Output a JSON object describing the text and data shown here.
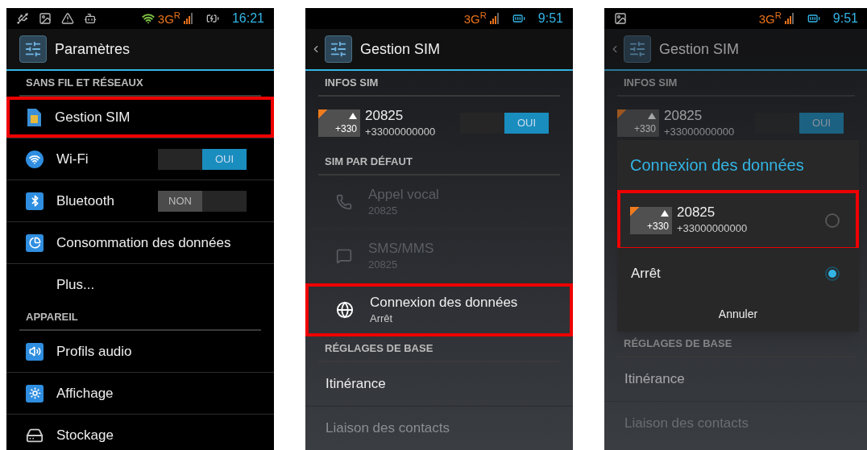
{
  "screens": [
    {
      "dimmed": false,
      "status_bar": {
        "wifi": true,
        "network": "3G$^{R}$",
        "charging": true,
        "time": "16:21"
      },
      "action_bar": {
        "title": "Paramètres"
      },
      "sections": [
        {
          "kind": "group",
          "header": "SANS FIL ET RÉSEAUX",
          "items": [
            {
              "kind": "sim",
              "label": "Gestion SIM",
              "highlighted": true
            },
            {
              "kind": "wifi",
              "label": "Wi-Fi",
              "on": true,
              "toggle_label": "OUI",
              "highlighted": false
            },
            {
              "kind": "bluetooth",
              "label": "Bluetooth",
              "on": false,
              "toggle_label": "NON",
              "highlighted": false
            },
            {
              "kind": "data",
              "label": "Consommation des données",
              "highlighted": false
            },
            {
              "kind": "more",
              "label": "Plus...",
              "highlighted": false
            }
          ]
        },
        {
          "kind": "group",
          "header": "APPAREIL",
          "items": [
            {
              "kind": "audio",
              "label": "Profils audio",
              "highlighted": false
            },
            {
              "kind": "display",
              "label": "Affichage",
              "highlighted": false
            },
            {
              "kind": "storage",
              "label": "Stockage",
              "highlighted": false
            }
          ]
        }
      ]
    },
    {
      "dimmed": false,
      "status_bar": {
        "network": "3G$^{R}$",
        "charging": false,
        "time": "9:51"
      },
      "action_bar": {
        "back": true,
        "title": "Gestion SIM"
      },
      "sections": [
        {
          "kind": "group",
          "header": "INFOS SIM",
          "items": [
            {
              "kind": "sim_entry",
              "badge": "+330",
              "name": "20825",
              "number": "+33000000000",
              "on": true,
              "toggle_label": "OUI",
              "highlighted": false
            }
          ]
        },
        {
          "kind": "group",
          "header": "SIM PAR DÉFAUT",
          "items": [
            {
              "kind": "phone",
              "label": "Appel vocal",
              "sub": "20825",
              "disabled": true,
              "highlighted": false
            },
            {
              "kind": "sms",
              "label": "SMS/MMS",
              "sub": "20825",
              "disabled": true,
              "highlighted": false
            },
            {
              "kind": "globe",
              "label": "Connexion des données",
              "sub": "Arrêt",
              "disabled": false,
              "highlighted": true
            }
          ]
        },
        {
          "kind": "group",
          "header": "RÉGLAGES DE BASE",
          "items": [
            {
              "kind": "text",
              "label": "Itinérance",
              "disabled": false,
              "highlighted": false
            },
            {
              "kind": "text",
              "label": "Liaison des contacts",
              "disabled": true,
              "highlighted": false
            }
          ]
        }
      ]
    },
    {
      "dimmed": true,
      "status_bar": {
        "network": "3G$^{R}$",
        "charging": false,
        "time": "9:51"
      },
      "action_bar": {
        "back": true,
        "title": "Gestion SIM"
      },
      "sections": [
        {
          "kind": "group",
          "header": "INFOS SIM",
          "items": [
            {
              "kind": "sim_entry",
              "badge": "+330",
              "name": "20825",
              "number": "+33000000000",
              "on": true,
              "toggle_label": "OUI",
              "highlighted": false
            }
          ]
        },
        {
          "kind": "dialog",
          "title": "Connexion des données",
          "button": "Annuler",
          "options": [
            {
              "kind": "sim",
              "badge": "+330",
              "name": "20825",
              "number": "+33000000000",
              "selected": false,
              "highlighted": true
            },
            {
              "kind": "text",
              "label": "Arrêt",
              "selected": true,
              "highlighted": false
            }
          ]
        },
        {
          "kind": "group",
          "header": "RÉGLAGES DE BASE",
          "items": [
            {
              "kind": "text",
              "label": "Itinérance",
              "disabled": false,
              "highlighted": false
            },
            {
              "kind": "text",
              "label": "Liaison des contacts",
              "disabled": true,
              "highlighted": false
            }
          ]
        }
      ]
    }
  ]
}
